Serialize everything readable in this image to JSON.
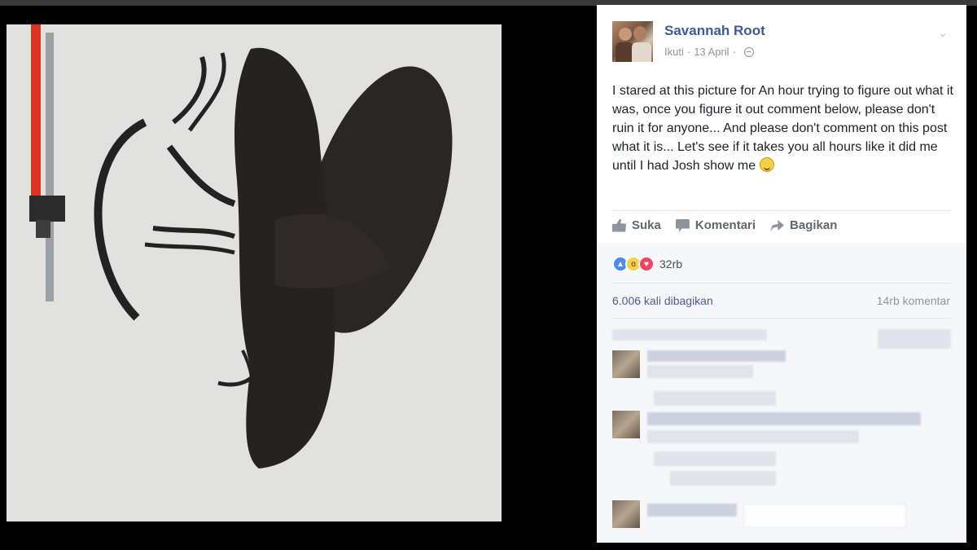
{
  "post": {
    "author": "Savannah Root",
    "follow_label": "Ikuti",
    "date": "13 April",
    "text": "I stared at this picture for An hour trying to figure out what it was, once you figure it out comment below, please don't ruin it for anyone... And please don't comment on this post what it is... Let's see if it takes you all hours like it did me until I had Josh show me",
    "privacy_icon": "globe-icon",
    "menu_icon": "chevron-down-icon"
  },
  "actions": {
    "like_label": "Suka",
    "comment_label": "Komentari",
    "share_label": "Bagikan"
  },
  "reactions": {
    "types": [
      "like",
      "wow",
      "love"
    ],
    "count": "32rb"
  },
  "stats": {
    "shares": "6.006 kali dibagikan",
    "comments": "14rb komentar"
  },
  "colors": {
    "brand_link": "#3b5998",
    "panel_bg": "#ffffff",
    "footer_bg": "#f6f7f9",
    "page_bg": "#000000"
  }
}
